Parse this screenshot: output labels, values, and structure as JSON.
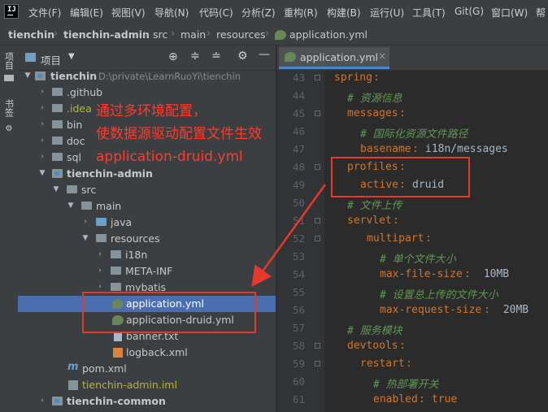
{
  "menubar": {
    "items": [
      "文件(F)",
      "编辑(E)",
      "视图(V)",
      "导航(N)",
      "代码(C)",
      "分析(Z)",
      "重构(R)",
      "构建(B)",
      "运行(U)",
      "工具(T)",
      "Git(G)",
      "窗口(W)",
      "帮"
    ]
  },
  "breadcrumb": {
    "items": [
      "tienchin",
      "tienchin-admin",
      "src",
      "main",
      "resources",
      "application.yml"
    ]
  },
  "left_strip": {
    "project": "项目",
    "bookmarks": "书签"
  },
  "panel": {
    "title": "项目"
  },
  "tree": [
    {
      "label": "tienchin",
      "path": "D:\\private\\LearnRuoYi\\tienchin"
    },
    {
      "label": ".github"
    },
    {
      "label": ".idea"
    },
    {
      "label": "bin"
    },
    {
      "label": "doc"
    },
    {
      "label": "sql"
    },
    {
      "label": "tienchin-admin"
    },
    {
      "label": "src"
    },
    {
      "label": "main"
    },
    {
      "label": "java"
    },
    {
      "label": "resources"
    },
    {
      "label": "i18n"
    },
    {
      "label": "META-INF"
    },
    {
      "label": "mybatis"
    },
    {
      "label": "application.yml"
    },
    {
      "label": "application-druid.yml"
    },
    {
      "label": "banner.txt"
    },
    {
      "label": "logback.xml"
    },
    {
      "label": "pom.xml"
    },
    {
      "label": "tienchin-admin.iml"
    },
    {
      "label": "tienchin-common"
    }
  ],
  "annotation": {
    "line1": "通过多环境配置，",
    "line2": "使数据源驱动配置文件生效",
    "line3": "application-druid.yml",
    "color": "#ff3b2f"
  },
  "editor": {
    "tab_label": "application.yml",
    "lines": [
      {
        "n": "43",
        "key": "spring",
        "val": "",
        "comment": ""
      },
      {
        "n": "44",
        "key": "",
        "val": "",
        "comment": "# 资源信息"
      },
      {
        "n": "45",
        "key": "messages",
        "val": "",
        "comment": ""
      },
      {
        "n": "46",
        "key": "",
        "val": "",
        "comment": "# 国际化资源文件路径"
      },
      {
        "n": "47",
        "key": "basename",
        "val": "i18n/messages",
        "comment": ""
      },
      {
        "n": "48",
        "key": "profiles",
        "val": "",
        "comment": ""
      },
      {
        "n": "49",
        "key": "active",
        "val": "druid",
        "comment": ""
      },
      {
        "n": "50",
        "key": "",
        "val": "",
        "comment": "# 文件上传"
      },
      {
        "n": "51",
        "key": "servlet",
        "val": "",
        "comment": ""
      },
      {
        "n": "52",
        "key": "multipart",
        "val": "",
        "comment": ""
      },
      {
        "n": "53",
        "key": "",
        "val": "",
        "comment": "# 单个文件大小"
      },
      {
        "n": "54",
        "key": "max-file-size",
        "val": " 10MB",
        "comment": ""
      },
      {
        "n": "55",
        "key": "",
        "val": "",
        "comment": "# 设置总上传的文件大小"
      },
      {
        "n": "56",
        "key": "max-request-size",
        "val": " 20MB",
        "comment": ""
      },
      {
        "n": "57",
        "key": "",
        "val": "",
        "comment": "# 服务模块"
      },
      {
        "n": "58",
        "key": "devtools",
        "val": "",
        "comment": ""
      },
      {
        "n": "59",
        "key": "restart",
        "val": "",
        "comment": ""
      },
      {
        "n": "60",
        "key": "",
        "val": "",
        "comment": "# 热部署开关"
      },
      {
        "n": "61",
        "key": "enabled",
        "val": "true",
        "comment": ""
      }
    ]
  }
}
